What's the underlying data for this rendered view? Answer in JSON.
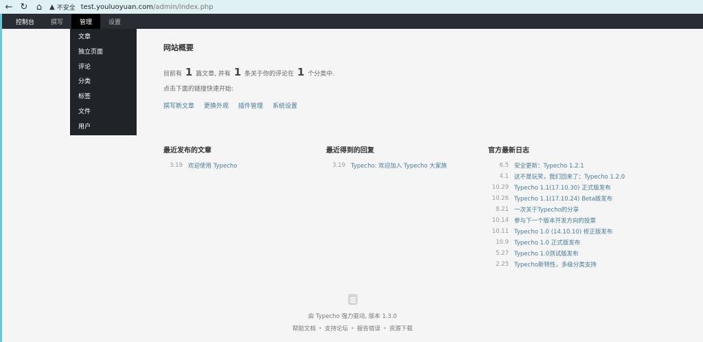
{
  "browser": {
    "insecure_label": "不安全",
    "url_host": "test.youluoyuan.com",
    "url_path": "/admin/index.php"
  },
  "topnav": {
    "items": [
      "控制台",
      "撰写",
      "管理",
      "设置"
    ]
  },
  "dropdown": {
    "items": [
      "文章",
      "独立页面",
      "评论",
      "分类",
      "标签",
      "文件",
      "用户"
    ]
  },
  "overview": {
    "title": "网站概要",
    "s1": "目前有",
    "posts": "1",
    "s2": "篇文章, 并有",
    "comments": "1",
    "s3": "条关于你的评论在",
    "categories": "1",
    "s4": "个分类中.",
    "hint": "点击下面的链接快速开始:",
    "links": [
      "撰写新文章",
      "更换外观",
      "插件管理",
      "系统设置"
    ]
  },
  "recent_posts": {
    "title": "最近发布的文章",
    "items": [
      {
        "date": "3.19",
        "text": "欢迎使用 Typecho"
      }
    ]
  },
  "recent_comments": {
    "title": "最近得到的回复",
    "items": [
      {
        "date": "3.19",
        "text": "Typecho: 欢迎加入 Typecho 大家族"
      }
    ]
  },
  "official_log": {
    "title": "官方最新日志",
    "items": [
      {
        "date": "6.5",
        "text": "安全更新：Typecho 1.2.1"
      },
      {
        "date": "4.1",
        "text": "这不是玩笑，我们回来了：Typecho 1.2.0"
      },
      {
        "date": "10.29",
        "text": "Typecho 1.1(17.10.30) 正式版发布"
      },
      {
        "date": "10.26",
        "text": "Typecho 1.1(17.10.24) Beta版发布"
      },
      {
        "date": "8.21",
        "text": "一次关于Typecho的分享"
      },
      {
        "date": "10.14",
        "text": "参与下一个版本开发方向的投票"
      },
      {
        "date": "10.11",
        "text": "Typecho 1.0 (14.10.10) 修正版发布"
      },
      {
        "date": "10.9",
        "text": "Typecho 1.0 正式版发布"
      },
      {
        "date": "5.27",
        "text": "Typecho 1.0测试版发布"
      },
      {
        "date": "2.25",
        "text": "Typecho新特性，多级分类支持"
      }
    ]
  },
  "footer": {
    "powered": "由 Typecho 强力驱动, 版本 1.3.0",
    "links": [
      "帮助文档",
      "支持论坛",
      "报告错误",
      "资源下载"
    ]
  }
}
